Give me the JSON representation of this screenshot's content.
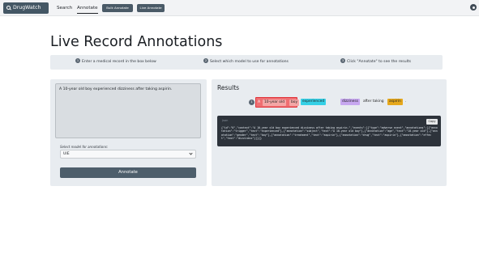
{
  "nav": {
    "brand": "DrugWatch",
    "links": [
      "Search",
      "Annotate"
    ],
    "buttons": [
      "Bulk Annotate",
      "Live Annotate"
    ]
  },
  "page_title": "Live Record Annotations",
  "steps": [
    {
      "num": "1",
      "text": "Enter a medical record in the box below"
    },
    {
      "num": "2",
      "text": "Select which model to use for annotations"
    },
    {
      "num": "3",
      "text": "Click \"Annotate\" to see the results"
    }
  ],
  "input": {
    "value": "A 10-year old boy experienced dizziness after taking aspirin.",
    "model_label": "Select model for annotations:",
    "model_selected": "UIE",
    "annotate_label": "Annotate"
  },
  "results": {
    "title": "Results",
    "marker": "1",
    "event_prefix": "A",
    "entities": {
      "age": "10-year old",
      "gender": "boy",
      "trigger": "experienced",
      "effect": "dizziness",
      "drug": "aspirin"
    },
    "between_text": "after taking",
    "period": ".",
    "code_lang": "json",
    "copy_label": "Copy",
    "json": "{\"id\":\"0\",\"context\":\"A 10-year old boy experienced dizziness after taking aspirin.\",\"events\":[{\"type\":\"adverse event\",\"annotations\":[{\"annotation\":\"trigger\",\"text\":\"experienced\"},{\"annotation\":\"subject\",\"text\":\"A 10-year old boy\"},{\"annotation\":\"age\",\"text\":\"10-year old\"},{\"annotation\":\"gender\",\"text\":\"boy\"},{\"annotation\":\"treatment\",\"text\":\"aspirin\"},{\"annotation\":\"drug\",\"text\":\"aspirin\"},{\"annotation\":\"effect\",\"text\":\"dizziness\"}]}]}"
  },
  "colors": {
    "nav_dark": "#445765",
    "event_red": "#ef6f72",
    "age_pink": "#f4a6a6",
    "trigger_cyan": "#35d0e6",
    "effect_violet": "#c7a7f0",
    "drug_orange": "#e6a81c"
  }
}
